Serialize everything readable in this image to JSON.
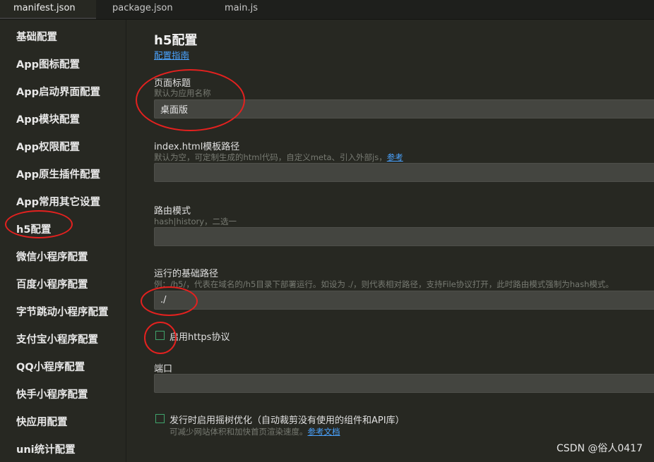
{
  "tabs": [
    "manifest.json",
    "package.json",
    "main.js"
  ],
  "sidebar": {
    "items": [
      "基础配置",
      "App图标配置",
      "App启动界面配置",
      "App模块配置",
      "App权限配置",
      "App原生插件配置",
      "App常用其它设置",
      "h5配置",
      "微信小程序配置",
      "百度小程序配置",
      "字节跳动小程序配置",
      "支付宝小程序配置",
      "QQ小程序配置",
      "快手小程序配置",
      "快应用配置",
      "uni统计配置"
    ],
    "active": "h5配置"
  },
  "main": {
    "title": "h5配置",
    "guide_link": "配置指南",
    "page_title": {
      "label": "页面标题",
      "hint": "默认为应用名称",
      "value": "桌面版"
    },
    "template_path": {
      "label": "index.html模板路径",
      "hint": "默认为空，可定制生成的html代码，自定义meta、引入外部js，",
      "hint_link": "参考",
      "value": ""
    },
    "router_mode": {
      "label": "路由模式",
      "hint": "hash|history，二选一",
      "value": ""
    },
    "base_path": {
      "label": "运行的基础路径",
      "hint": "例：/h5/，代表在域名的/h5目录下部署运行。如设为 ./，则代表相对路径，支持File协议打开，此时路由模式强制为hash模式。",
      "value": "./"
    },
    "https": {
      "label": "启用https协议",
      "checked": false
    },
    "port": {
      "label": "端口",
      "value": ""
    },
    "treeshake": {
      "label": "发行时启用摇树优化（自动裁剪没有使用的组件和API库）",
      "hint": "可减少网站体积和加快首页渲染速度。",
      "hint_link": "参考文档",
      "checked": false
    }
  },
  "watermark": "CSDN @俗人0417",
  "colors": {
    "background": "#272822",
    "input_bg": "#444540",
    "link": "#4aa3ff",
    "checkbox_border": "#3fa36b",
    "annotation": "#e4211f"
  }
}
